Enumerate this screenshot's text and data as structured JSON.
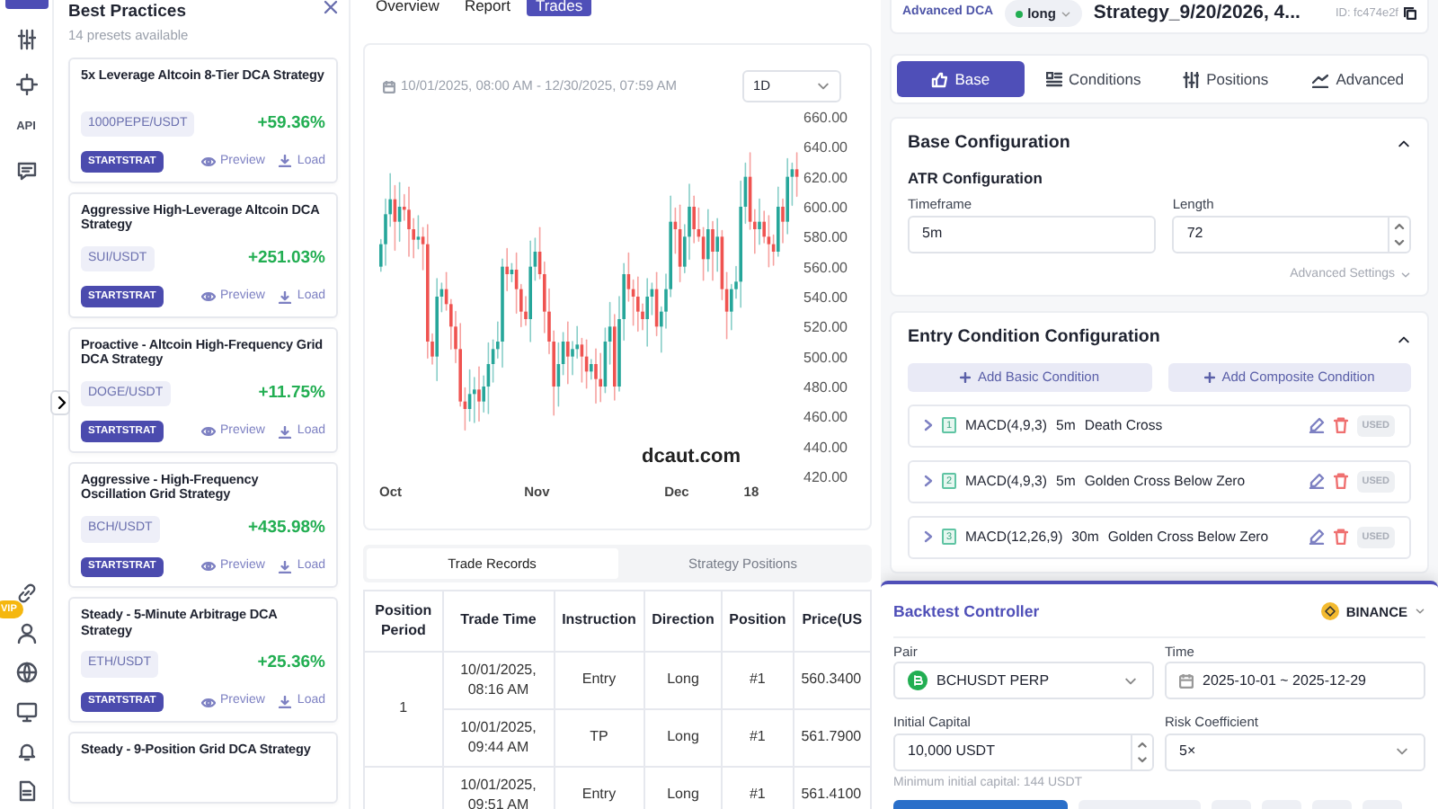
{
  "rail": {
    "api_label": "API",
    "vip_badge": "VIP"
  },
  "presets": {
    "title": "Best Practices",
    "subtitle": "14 presets available",
    "items": [
      {
        "title": "5x Leverage Altcoin 8-Tier DCA Strategy",
        "pair": "1000PEPE/USDT",
        "return": "+59.36%",
        "badge": "STARTSTRAT",
        "preview": "Preview",
        "load": "Load"
      },
      {
        "title": "Aggressive High-Leverage Altcoin DCA Strategy",
        "pair": "SUI/USDT",
        "return": "+251.03%",
        "badge": "STARTSTRAT",
        "preview": "Preview",
        "load": "Load"
      },
      {
        "title": "Proactive - Altcoin High-Frequency Grid DCA Strategy",
        "pair": "DOGE/USDT",
        "return": "+11.75%",
        "badge": "STARTSTRAT",
        "preview": "Preview",
        "load": "Load"
      },
      {
        "title": "Aggressive - High-Frequency Oscillation Grid Strategy",
        "pair": "BCH/USDT",
        "return": "+435.98%",
        "badge": "STARTSTRAT",
        "preview": "Preview",
        "load": "Load"
      },
      {
        "title": "Steady - 5-Minute Arbitrage DCA Strategy",
        "pair": "ETH/USDT",
        "return": "+25.36%",
        "badge": "STARTSTRAT",
        "preview": "Preview",
        "load": "Load"
      },
      {
        "title": "Steady - 9-Position Grid DCA Strategy"
      }
    ]
  },
  "view_tabs": [
    {
      "label": "Overview",
      "selected": false
    },
    {
      "label": "Report",
      "selected": false
    },
    {
      "label": "Trades",
      "selected": true
    }
  ],
  "chart": {
    "date_range": "10/01/2025, 08:00 AM - 12/30/2025, 07:59 AM",
    "interval": "1D",
    "y_ticks": [
      "660.00",
      "640.00",
      "620.00",
      "600.00",
      "580.00",
      "560.00",
      "540.00",
      "520.00",
      "500.00",
      "480.00",
      "460.00",
      "440.00",
      "420.00"
    ],
    "x_labels": [
      "Oct",
      "Nov",
      "Dec",
      "18"
    ],
    "watermark": "dcaut.com"
  },
  "record_tabs": [
    {
      "label": "Trade Records",
      "selected": true
    },
    {
      "label": "Strategy Positions",
      "selected": false
    }
  ],
  "table": {
    "columns": [
      "Position Period",
      "Trade Time",
      "Instruction",
      "Direction",
      "Position",
      "Price(US"
    ],
    "groups": [
      {
        "period": "1",
        "trades": [
          {
            "time": "10/01/2025, 08:16 AM",
            "instruction": "Entry",
            "direction": "Long",
            "position": "#1",
            "price": "560.3400"
          },
          {
            "time": "10/01/2025, 09:44 AM",
            "instruction": "TP",
            "direction": "Long",
            "position": "#1",
            "price": "561.7900"
          }
        ]
      },
      {
        "trades": [
          {
            "time": "10/01/2025, 09:51 AM",
            "instruction": "Entry",
            "direction": "Long",
            "position": "#1",
            "price": "561.4100"
          }
        ]
      }
    ]
  },
  "strategy": {
    "type": "Advanced DCA",
    "direction": "long",
    "name": "Strategy_9/20/2026, 4...",
    "id": "ID: fc474e2f"
  },
  "config_tabs": [
    {
      "label": "Base",
      "selected": true
    },
    {
      "label": "Conditions",
      "selected": false
    },
    {
      "label": "Positions",
      "selected": false
    },
    {
      "label": "Advanced",
      "selected": false
    }
  ],
  "base_config": {
    "title": "Base Configuration",
    "expanded": true,
    "section": "ATR Configuration",
    "fields": [
      {
        "label": "Timeframe",
        "value": "5m",
        "kind": "text"
      },
      {
        "label": "Length",
        "value": "72",
        "kind": "number"
      }
    ],
    "advanced_link": "Advanced Settings"
  },
  "entry_conditions": {
    "title": "Entry Condition Configuration",
    "expanded": true,
    "buttons": [
      "Add Basic Condition",
      "Add Composite Condition"
    ],
    "conditions": [
      {
        "index": "1",
        "indicator": "MACD(4,9,3)",
        "timeframe": "5m",
        "signal": "Death Cross",
        "status": "USED"
      },
      {
        "index": "2",
        "indicator": "MACD(4,9,3)",
        "timeframe": "5m",
        "signal": "Golden Cross Below Zero",
        "status": "USED"
      },
      {
        "index": "3",
        "indicator": "MACD(12,26,9)",
        "timeframe": "30m",
        "signal": "Golden Cross Below Zero",
        "status": "USED"
      }
    ]
  },
  "backtest": {
    "title": "Backtest Controller",
    "exchange": "BINANCE",
    "fields": [
      {
        "label": "Pair",
        "value": "BCHUSDT PERP",
        "kind": "select"
      },
      {
        "label": "Time",
        "value": "2025-10-01 ~ 2025-12-29",
        "kind": "date"
      },
      {
        "label": "Initial Capital",
        "value": "10,000 USDT",
        "kind": "number"
      },
      {
        "label": "Risk Coefficient",
        "value": "5×",
        "kind": "select"
      }
    ],
    "hint": "Minimum initial capital: 144 USDT"
  }
}
